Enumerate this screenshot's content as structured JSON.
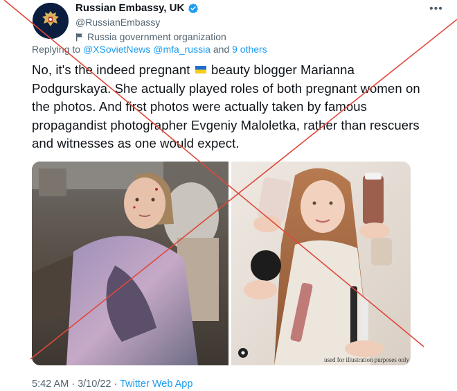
{
  "account": {
    "name": "Russian Embassy, UK",
    "handle": "@RussianEmbassy",
    "label": "Russia government organization"
  },
  "reply": {
    "prefix": "Replying to",
    "to": "@XSovietNews @mfa_russia",
    "and_more": "and 9 others"
  },
  "tweet": {
    "text_before_flag": "No, it's the indeed pregnant",
    "text_after_flag": "beauty blogger Marianna Podgurskaya. She actually played roles of both pregnant women on the photos. And first photos were actually taken by famous propagandist photographer Evgeniy Maloletka, rather than rescuers and witnesses as one would expect."
  },
  "media": {
    "right_watermark": "used for illustration purposes only"
  },
  "footer": {
    "time": "5:42 AM",
    "date": "3/10/22",
    "source": "Twitter Web App"
  },
  "colors": {
    "accent": "#1d9bf0",
    "cross_line": "#e0483a"
  },
  "icons": [
    "verified-badge-icon",
    "government-flag-icon",
    "more-options-icon",
    "ukraine-flag-icon"
  ]
}
